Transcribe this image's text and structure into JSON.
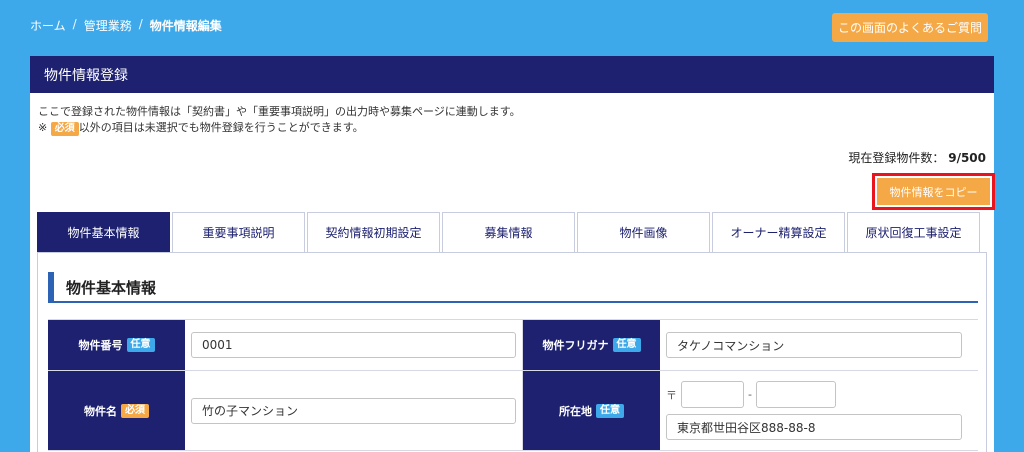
{
  "breadcrumb": {
    "home": "ホーム",
    "sep": "/",
    "section": "管理業務",
    "current": "物件情報編集"
  },
  "faq_button": "この画面のよくあるご質問",
  "panel": {
    "title": "物件情報登録",
    "notice_line1": "ここで登録された物件情報は「契約書」や「重要事項説明」の出力時や募集ページに連動します。",
    "notice_prefix": "※",
    "notice_line2_suffix": "以外の項目は未選択でも物件登録を行うことができます。",
    "count_label": "現在登録物件数：",
    "count_value": "9/500",
    "copy_button": "物件情報をコピー"
  },
  "badges": {
    "required": "必須",
    "optional": "任意"
  },
  "tabs": [
    {
      "label": "物件基本情報",
      "active": true
    },
    {
      "label": "重要事項説明"
    },
    {
      "label": "契約情報初期設定"
    },
    {
      "label": "募集情報"
    },
    {
      "label": "物件画像"
    },
    {
      "label": "オーナー精算設定"
    },
    {
      "label": "原状回復工事設定"
    }
  ],
  "section": {
    "title": "物件基本情報"
  },
  "fields": {
    "property_number": {
      "label": "物件番号",
      "value": "0001"
    },
    "property_kana": {
      "label": "物件フリガナ",
      "value": "タケノコマンション"
    },
    "property_name": {
      "label": "物件名",
      "value": "竹の子マンション"
    },
    "address": {
      "label": "所在地",
      "zip_mark": "〒",
      "zip_dash": "-",
      "value": "東京都世田谷区888-88-8"
    }
  },
  "colors": {
    "background": "#3ea9ea",
    "navy": "#1d2170",
    "accent_orange": "#f5a846",
    "highlight_red": "#e8141e"
  }
}
